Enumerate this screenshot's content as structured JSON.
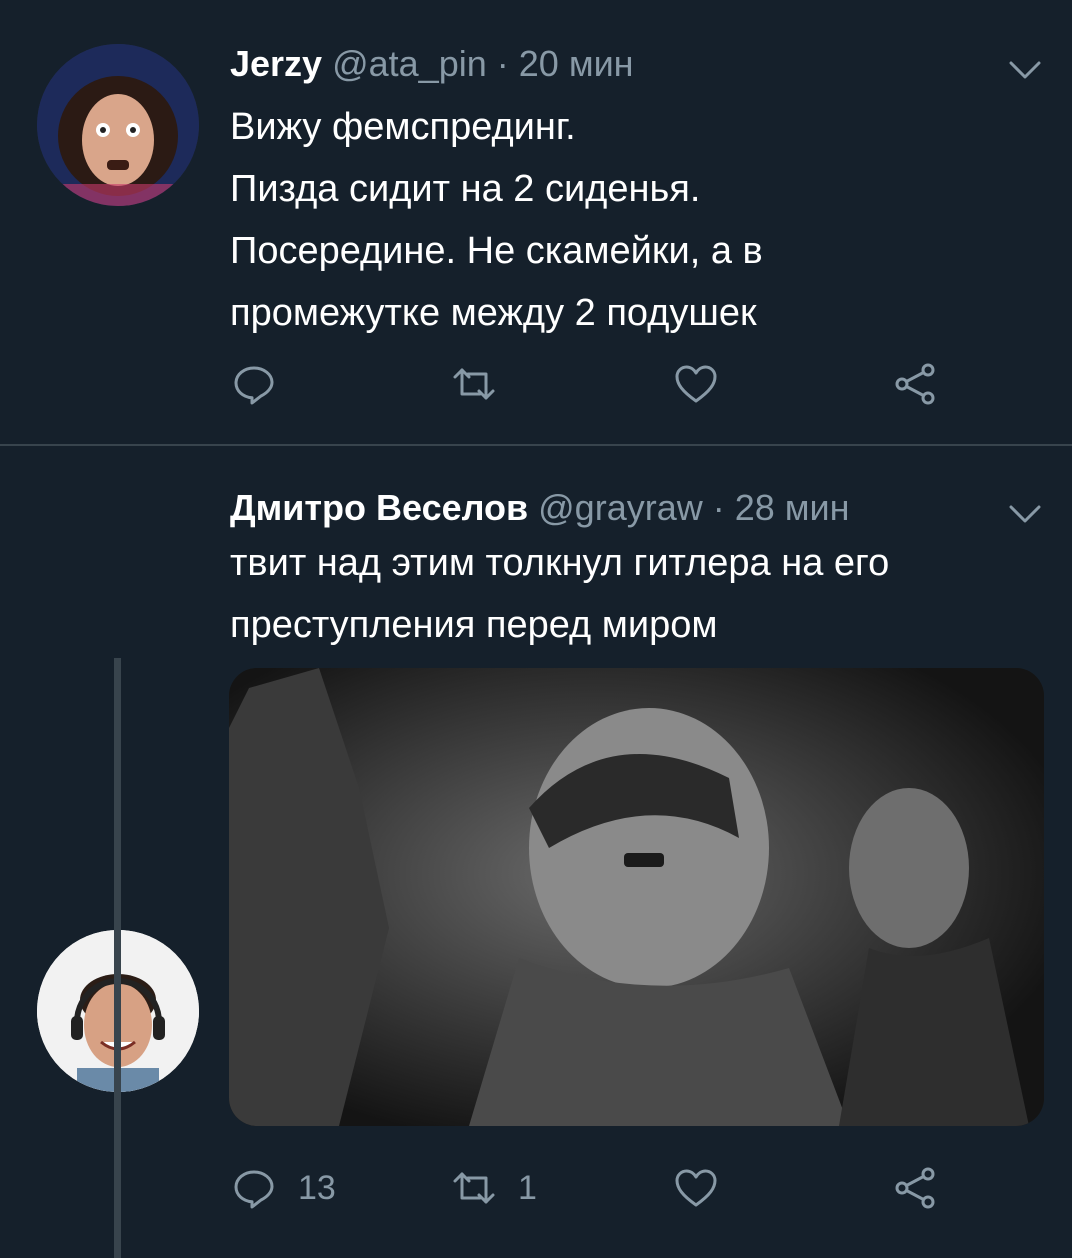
{
  "tweets": [
    {
      "name": "Jerzy",
      "handle": "@ata_pin",
      "separator": "·",
      "time": "20 мин",
      "lines": [
        "Вижу фемспрединг.",
        "Пизда сидит на 2 сиденья.",
        "Посередине. Не скамейки, а в",
        "промежутке между 2 подушек"
      ],
      "actions": {
        "reply_icon": "reply-icon",
        "retweet_icon": "retweet-icon",
        "like_icon": "heart-icon",
        "share_icon": "share-icon"
      }
    },
    {
      "name": "Дмитро Веселов",
      "handle": "@grayraw",
      "separator": "·",
      "time": "28 мин",
      "lines": [
        "твит над этим толкнул гитлера на его",
        "преступления перед миром"
      ],
      "actions": {
        "reply_count": "13",
        "retweet_count": "1"
      }
    }
  ],
  "colors": {
    "background": "#15202b",
    "text": "#ffffff",
    "muted": "#8899a6",
    "divider": "#38444d"
  }
}
